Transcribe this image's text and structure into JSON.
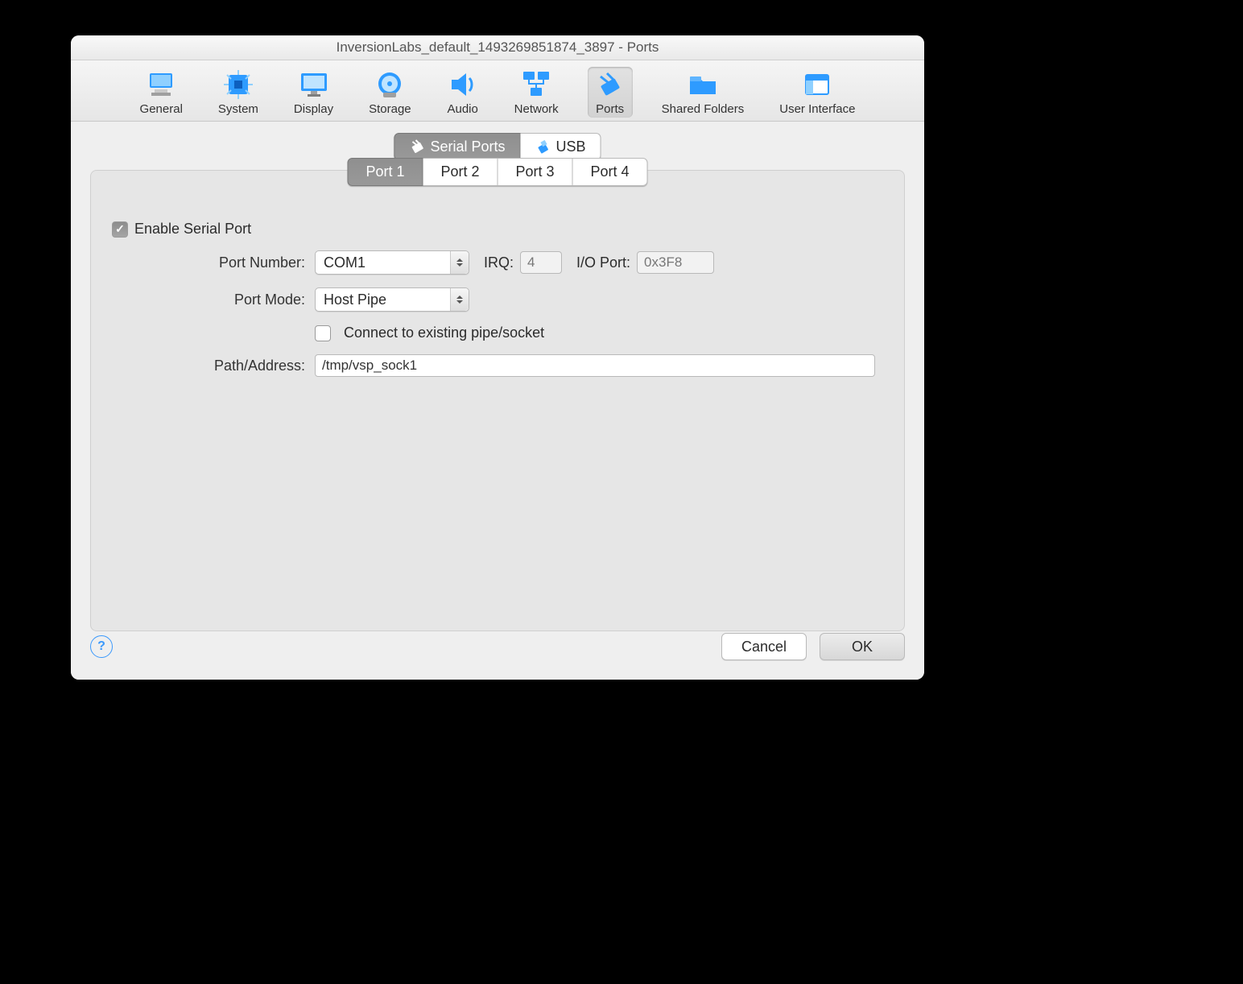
{
  "window": {
    "title": "InversionLabs_default_1493269851874_3897 - Ports"
  },
  "toolbar": {
    "items": [
      {
        "label": "General"
      },
      {
        "label": "System"
      },
      {
        "label": "Display"
      },
      {
        "label": "Storage"
      },
      {
        "label": "Audio"
      },
      {
        "label": "Network"
      },
      {
        "label": "Ports"
      },
      {
        "label": "Shared Folders"
      },
      {
        "label": "User Interface"
      }
    ]
  },
  "subtabs": {
    "items": [
      {
        "label": "Serial Ports"
      },
      {
        "label": "USB"
      }
    ]
  },
  "porttabs": {
    "items": [
      {
        "label": "Port 1"
      },
      {
        "label": "Port 2"
      },
      {
        "label": "Port 3"
      },
      {
        "label": "Port 4"
      }
    ]
  },
  "form": {
    "enable_label": "Enable Serial Port",
    "portnum_label": "Port Number:",
    "portnum_value": "COM1",
    "irq_label": "IRQ:",
    "irq_value": "4",
    "ioport_label": "I/O Port:",
    "ioport_value": "0x3F8",
    "mode_label": "Port Mode:",
    "mode_value": "Host Pipe",
    "connect_label": "Connect to existing pipe/socket",
    "path_label": "Path/Address:",
    "path_value": "/tmp/vsp_sock1"
  },
  "footer": {
    "help": "?",
    "cancel": "Cancel",
    "ok": "OK"
  }
}
